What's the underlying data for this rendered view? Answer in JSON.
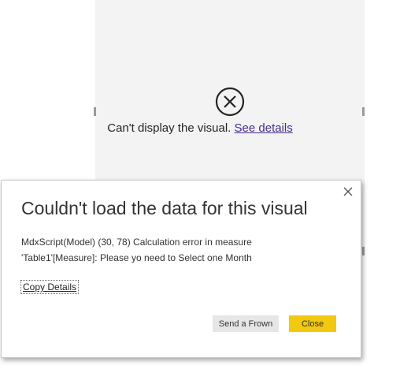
{
  "visual": {
    "message": "Can't display the visual.",
    "link_label": "See details"
  },
  "dialog": {
    "title": "Couldn't load the data for this visual",
    "body_line1": "MdxScript(Model) (30, 78) Calculation error in measure",
    "body_line2": "'Table1'[Measure]: Please yo need to Select one Month",
    "copy_details_label": "Copy Details",
    "send_frown_label": "Send a Frown",
    "close_label": "Close"
  },
  "colors": {
    "panel_bg": "#f3f3f3",
    "link": "#4a2c8c",
    "primary_button": "#f2c811",
    "secondary_button": "#e6e6e6"
  },
  "icons": {
    "error": "circle-x-icon",
    "close": "close-icon"
  }
}
